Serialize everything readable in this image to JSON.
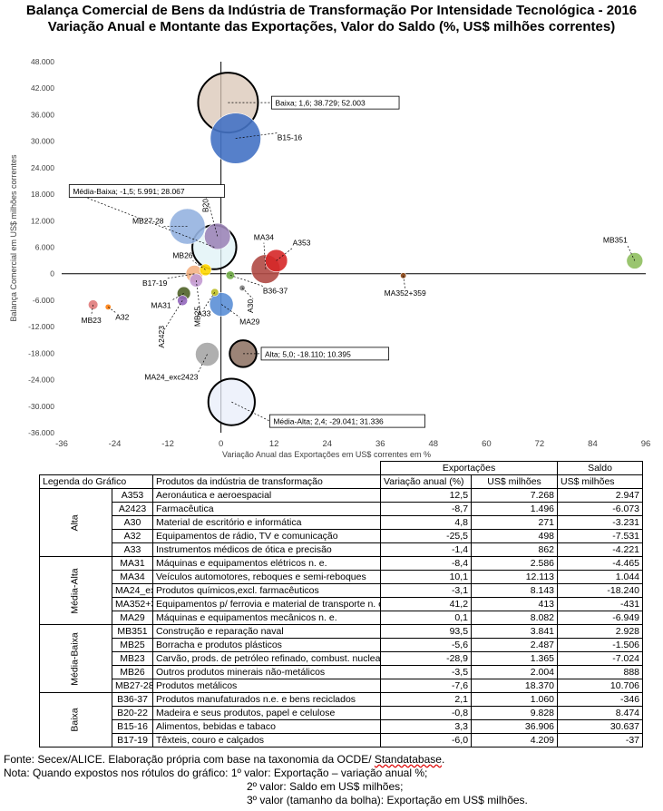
{
  "title_line1": "Balança Comercial de Bens da Indústria de Transformação Por Intensidade Tecnológica - 2016",
  "title_line2": "Variação Anual e Montante das Exportações, Valor do Saldo (%, US$ milhões correntes)",
  "chart_data": {
    "type": "scatter",
    "subtype": "bubble",
    "xlabel": "Variação Anual das Exportações em US$ correntes em %",
    "ylabel": "Balança Comercial em US$ milhões correntes",
    "xlim": [
      -36,
      96
    ],
    "ylim": [
      -36000,
      48000
    ],
    "xticks": [
      "-36",
      "-24",
      "-12",
      "0",
      "12",
      "24",
      "36",
      "48",
      "60",
      "72",
      "84",
      "96"
    ],
    "yticks": [
      "48.000",
      "42.000",
      "36.000",
      "30.000",
      "24.000",
      "18.000",
      "12.000",
      "6.000",
      "0",
      "-6.000",
      "-12.000",
      "-18.000",
      "-24.000",
      "-30.000",
      "-36.000"
    ],
    "grid": false,
    "points": [
      {
        "label": "A353",
        "x": 12.5,
        "y": 2947,
        "size": 7268,
        "color": "#d62728"
      },
      {
        "label": "A2423",
        "x": -8.7,
        "y": -6073,
        "size": 1496,
        "color": "#9467bd"
      },
      {
        "label": "A30",
        "x": 4.8,
        "y": -3231,
        "size": 271,
        "color": "#7f7f7f"
      },
      {
        "label": "A32",
        "x": -25.5,
        "y": -7531,
        "size": 498,
        "color": "#ff7f0e"
      },
      {
        "label": "A33",
        "x": -1.4,
        "y": -4221,
        "size": 862,
        "color": "#bcbd22"
      },
      {
        "label": "MA31",
        "x": -8.4,
        "y": -4465,
        "size": 2586,
        "color": "#4f6228"
      },
      {
        "label": "MA34",
        "x": 10.1,
        "y": 1044,
        "size": 12113,
        "color": "#b04a45"
      },
      {
        "label": "MA24_exc2423",
        "x": -3.1,
        "y": -18240,
        "size": 8143,
        "color": "#a6a6a6"
      },
      {
        "label": "MA352+359",
        "x": 41.2,
        "y": -431,
        "size": 413,
        "color": "#8b4513"
      },
      {
        "label": "MA29",
        "x": 0.1,
        "y": -6949,
        "size": 8082,
        "color": "#5b8fd6"
      },
      {
        "label": "MB351",
        "x": 93.5,
        "y": 2928,
        "size": 3841,
        "color": "#8fbf5f"
      },
      {
        "label": "MB25",
        "x": -5.6,
        "y": -1506,
        "size": 2487,
        "color": "#c39bd3"
      },
      {
        "label": "MB23",
        "x": -28.9,
        "y": -7024,
        "size": 1365,
        "color": "#e07b7b"
      },
      {
        "label": "MB26",
        "x": -3.5,
        "y": 888,
        "size": 2004,
        "color": "#ffd700"
      },
      {
        "label": "MB27-28",
        "x": -7.6,
        "y": 10706,
        "size": 18370,
        "color": "#95b3e0"
      },
      {
        "label": "B36-37",
        "x": 2.1,
        "y": -346,
        "size": 1060,
        "color": "#70ad47"
      },
      {
        "label": "B20-22",
        "x": -0.8,
        "y": 8474,
        "size": 9828,
        "color": "#9d86b8"
      },
      {
        "label": "B15-16",
        "x": 3.3,
        "y": 30637,
        "size": 36906,
        "color": "#4472c4"
      },
      {
        "label": "B17-19",
        "x": -6.0,
        "y": -37,
        "size": 4209,
        "color": "#f4b183"
      },
      {
        "label": "Baixa; 1,6; 38.729; 52.003",
        "x": 1.6,
        "y": 38729,
        "size": 52003,
        "color": "#d9c6b5",
        "group": true
      },
      {
        "label": "Média-Baixa; -1,5; 5.991; 28.067",
        "x": -1.5,
        "y": 5991,
        "size": 28067,
        "color": "#dff2f5",
        "group": true
      },
      {
        "label": "Alta; 5,0; -18.110; 10.395",
        "x": 5.0,
        "y": -18110,
        "size": 10395,
        "color": "#7b5b4a",
        "group": true
      },
      {
        "label": "Média-Alta; 2,4; -29.041; 31.336",
        "x": 2.4,
        "y": -29041,
        "size": 31336,
        "color": "#e8eefa",
        "group": true
      }
    ]
  },
  "table": {
    "header_group_export": "Exportações",
    "header_group_saldo": "Saldo",
    "col_legend": "Legenda do Gráfico",
    "col_products": "Produtos da indústria de transformação",
    "col_var": "Variação anual (%)",
    "col_exp": "US$ milhões",
    "col_saldo": "US$ milhões",
    "groups": [
      {
        "name": "Alta",
        "rows": [
          [
            "A353",
            "Aeronáutica e aeroespacial",
            "12,5",
            "7.268",
            "2.947"
          ],
          [
            "A2423",
            "Farmacêutica",
            "-8,7",
            "1.496",
            "-6.073"
          ],
          [
            "A30",
            "Material de escritório e informática",
            "4,8",
            "271",
            "-3.231"
          ],
          [
            "A32",
            "Equipamentos de rádio, TV e comunicação",
            "-25,5",
            "498",
            "-7.531"
          ],
          [
            "A33",
            "Instrumentos médicos de ótica e precisão",
            "-1,4",
            "862",
            "-4.221"
          ]
        ]
      },
      {
        "name": "Média-Alta",
        "rows": [
          [
            "MA31",
            "Máquinas e equipamentos elétricos n. e.",
            "-8,4",
            "2.586",
            "-4.465"
          ],
          [
            "MA34",
            "Veículos automotores, reboques e semi-reboques",
            "10,1",
            "12.113",
            "1.044"
          ],
          [
            "MA24_exc2423",
            "Produtos químicos,excl. farmacêuticos",
            "-3,1",
            "8.143",
            "-18.240"
          ],
          [
            "MA352+359",
            "Equipamentos p/ ferrovia e material de transporte n. e.",
            "41,2",
            "413",
            "-431"
          ],
          [
            "MA29",
            "Máquinas e equipamentos mecânicos  n. e.",
            "0,1",
            "8.082",
            "-6.949"
          ]
        ]
      },
      {
        "name": "Média-Baixa",
        "rows": [
          [
            "MB351",
            "Construção e reparação naval",
            "93,5",
            "3.841",
            "2.928"
          ],
          [
            "MB25",
            "Borracha e produtos plásticos",
            "-5,6",
            "2.487",
            "-1.506"
          ],
          [
            "MB23",
            "Carvão, prods. de petróleo refinado, combust. nuclear",
            "-28,9",
            "1.365",
            "-7.024"
          ],
          [
            "MB26",
            "Outros produtos minerais não-metálicos",
            "-3,5",
            "2.004",
            "888"
          ],
          [
            "MB27-28",
            "Produtos metálicos",
            "-7,6",
            "18.370",
            "10.706"
          ]
        ]
      },
      {
        "name": "Baixa",
        "rows": [
          [
            "B36-37",
            "Produtos manufaturados n.e. e bens reciclados",
            "2,1",
            "1.060",
            "-346"
          ],
          [
            "B20-22",
            "Madeira e seus produtos, papel e celulose",
            "-0,8",
            "9.828",
            "8.474"
          ],
          [
            "B15-16",
            "Alimentos, bebidas e tabaco",
            "3,3",
            "36.906",
            "30.637"
          ],
          [
            "B17-19",
            "Têxteis, couro e calçados",
            "-6,0",
            "4.209",
            "-37"
          ]
        ]
      }
    ]
  },
  "notes": {
    "source_prefix": "Fonte: Secex/ALICE. Elaboração própria com base na taxonomia da OCDE/ ",
    "source_link": "Standatabase",
    "source_suffix": ".",
    "note1": "Nota: Quando expostos nos rótulos do gráfico: 1º valor: Exportação – variação anual %;",
    "note2": "2º valor: Saldo em US$ milhões;",
    "note3": "3º valor (tamanho da bolha): Exportação em US$ milhões."
  }
}
